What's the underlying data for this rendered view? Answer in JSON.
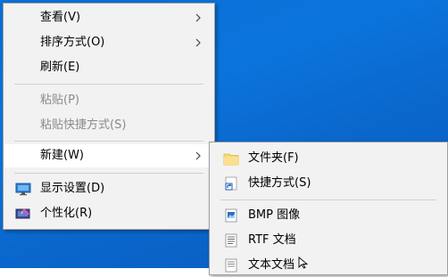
{
  "context_menu": {
    "items": [
      {
        "label": "查看(V)",
        "has_submenu": true
      },
      {
        "label": "排序方式(O)",
        "has_submenu": true
      },
      {
        "label": "刷新(E)"
      },
      {
        "label": "粘贴(P)",
        "disabled": true
      },
      {
        "label": "粘贴快捷方式(S)",
        "disabled": true
      },
      {
        "label": "新建(W)",
        "has_submenu": true,
        "hovered": true
      },
      {
        "label": "显示设置(D)",
        "icon": "display-settings-icon"
      },
      {
        "label": "个性化(R)",
        "icon": "personalize-icon"
      }
    ]
  },
  "new_submenu": {
    "items": [
      {
        "label": "文件夹(F)",
        "icon": "folder-icon"
      },
      {
        "label": "快捷方式(S)",
        "icon": "shortcut-icon"
      },
      {
        "label": "BMP 图像",
        "icon": "bmp-image-icon"
      },
      {
        "label": "RTF 文档",
        "icon": "rtf-document-icon"
      },
      {
        "label": "文本文档",
        "icon": "text-document-icon"
      }
    ]
  },
  "colors": {
    "desktop_blue": "#0b6fd6",
    "menu_bg": "#f2f2f2",
    "disabled_text": "#8a8a8a"
  }
}
